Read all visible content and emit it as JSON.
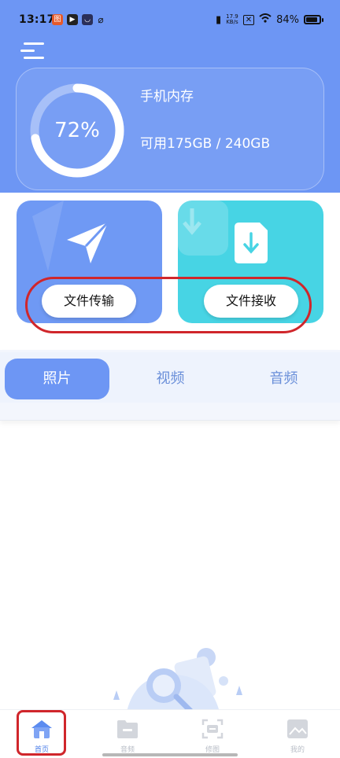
{
  "status_bar": {
    "time": "13:17",
    "net_speed_value": "17.9",
    "net_speed_unit": "KB/s",
    "battery": "84%"
  },
  "storage": {
    "percent": "72%",
    "percent_value": 0.72,
    "title": "手机内存",
    "available": "可用175GB / 240GB"
  },
  "actions": {
    "send_label": "文件传输",
    "receive_label": "文件接收"
  },
  "tabs": [
    {
      "label": "照片",
      "active": true
    },
    {
      "label": "视频",
      "active": false
    },
    {
      "label": "音频",
      "active": false
    }
  ],
  "bottom_nav": [
    {
      "label": "首页",
      "icon": "home-icon",
      "active": true
    },
    {
      "label": "音频",
      "icon": "folder-icon",
      "active": false
    },
    {
      "label": "修图",
      "icon": "crop-icon",
      "active": false
    },
    {
      "label": "我的",
      "icon": "picture-icon",
      "active": false
    }
  ],
  "colors": {
    "primary": "#6d96f4",
    "send_tile": "#6f99f4",
    "receive_tile": "#47d4e4",
    "highlight_red": "#d0262b"
  }
}
